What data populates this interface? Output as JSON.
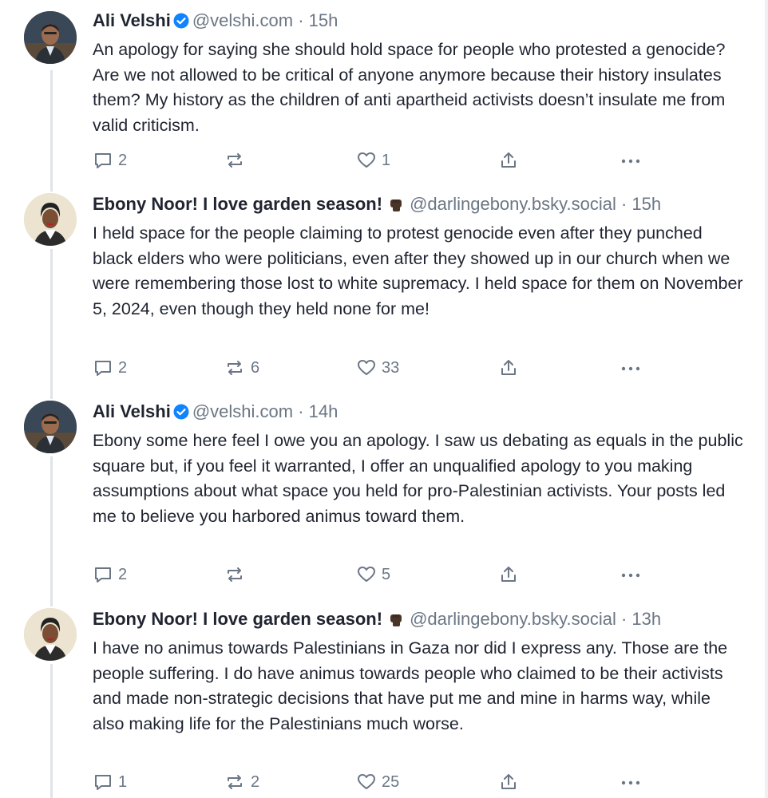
{
  "posts": [
    {
      "author": "Ali Velshi",
      "verified": true,
      "emoji": "",
      "handle": "@velshi.com",
      "separator": "·",
      "time": "15h",
      "text": "An apology for saying she should hold space for people who protested a genocide? Are we not allowed to be critical of anyone anymore because their history insulates them? My history as the children of anti apartheid activists doesn’t insulate me from valid criticism.",
      "replies": "2",
      "reposts": "",
      "likes": "1",
      "avatar": "man-avatar"
    },
    {
      "author": "Ebony Noor! I love garden season!",
      "verified": false,
      "emoji": "raised-fist-icon",
      "handle": "@darlingebony.bsky.social",
      "separator": "·",
      "time": "15h",
      "text": "I held space for the people claiming to protest genocide even after they punched black elders who were politicians, even after they showed up in our church when we were remembering those lost to white supremacy. I held space for them on November 5, 2024, even though they held none for me!",
      "replies": "2",
      "reposts": "6",
      "likes": "33",
      "avatar": "woman-avatar"
    },
    {
      "author": "Ali Velshi",
      "verified": true,
      "emoji": "",
      "handle": "@velshi.com",
      "separator": "·",
      "time": "14h",
      "text": "Ebony some here feel I owe you an apology. I saw us debating as equals in the public square but, if you feel it warranted, I offer an unqualified apology to you making assumptions about what space you held for pro-Palestinian activists. Your posts led me to believe you harbored animus toward them.",
      "replies": "2",
      "reposts": "",
      "likes": "5",
      "avatar": "man-avatar"
    },
    {
      "author": "Ebony Noor! I love garden season!",
      "verified": false,
      "emoji": "raised-fist-icon",
      "handle": "@darlingebony.bsky.social",
      "separator": "·",
      "time": "13h",
      "text": "I have no animus towards Palestinians in Gaza nor did I express any. Those are the people suffering. I do have animus towards people who claimed to be their activists and made non-strategic decisions that have put me and mine in harms way, while also making life for the Palestinians much worse.",
      "replies": "1",
      "reposts": "2",
      "likes": "25",
      "avatar": "woman-avatar"
    }
  ],
  "colors": {
    "text": "#1f2430",
    "muted": "#6b7685",
    "verified": "#1083fe",
    "thread_line": "#dfe4ea"
  },
  "icons": [
    "reply-icon",
    "repost-icon",
    "like-icon",
    "share-icon",
    "more-icon",
    "verified-badge-icon",
    "raised-fist-icon"
  ]
}
